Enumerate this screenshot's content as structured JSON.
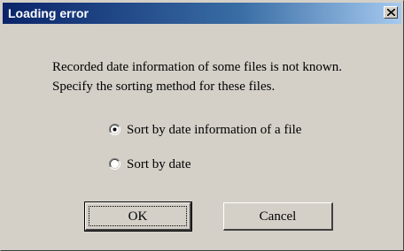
{
  "window": {
    "title": "Loading error",
    "close_icon": "close-icon"
  },
  "message": {
    "line1": "Recorded date information of some files is not known.",
    "line2": "Specify the sorting method for these files."
  },
  "options": [
    {
      "label": "Sort by date information of a file",
      "selected": true
    },
    {
      "label": "Sort by date",
      "selected": false
    }
  ],
  "buttons": {
    "ok": "OK",
    "cancel": "Cancel"
  },
  "colors": {
    "title_start": "#0a246a",
    "title_end": "#a6caf0",
    "face": "#d4d0c8"
  }
}
